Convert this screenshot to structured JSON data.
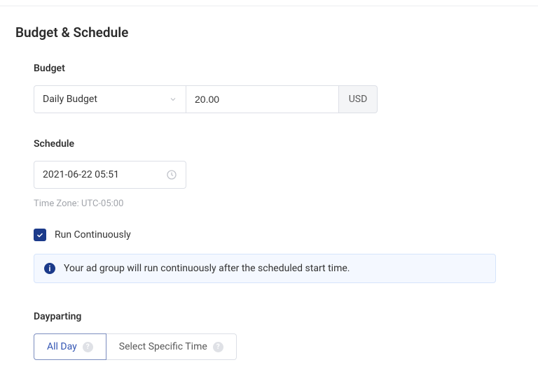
{
  "section_title": "Budget & Schedule",
  "budget": {
    "label": "Budget",
    "type_value": "Daily Budget",
    "amount": "20.00",
    "currency": "USD"
  },
  "schedule": {
    "label": "Schedule",
    "start_datetime": "2021-06-22 05:51",
    "timezone": "Time Zone: UTC-05:00",
    "run_continuously_label": "Run Continuously",
    "info_text": "Your ad group will run continuously after the scheduled start time."
  },
  "dayparting": {
    "label": "Dayparting",
    "option_all_day": "All Day",
    "option_specific": "Select Specific Time"
  }
}
